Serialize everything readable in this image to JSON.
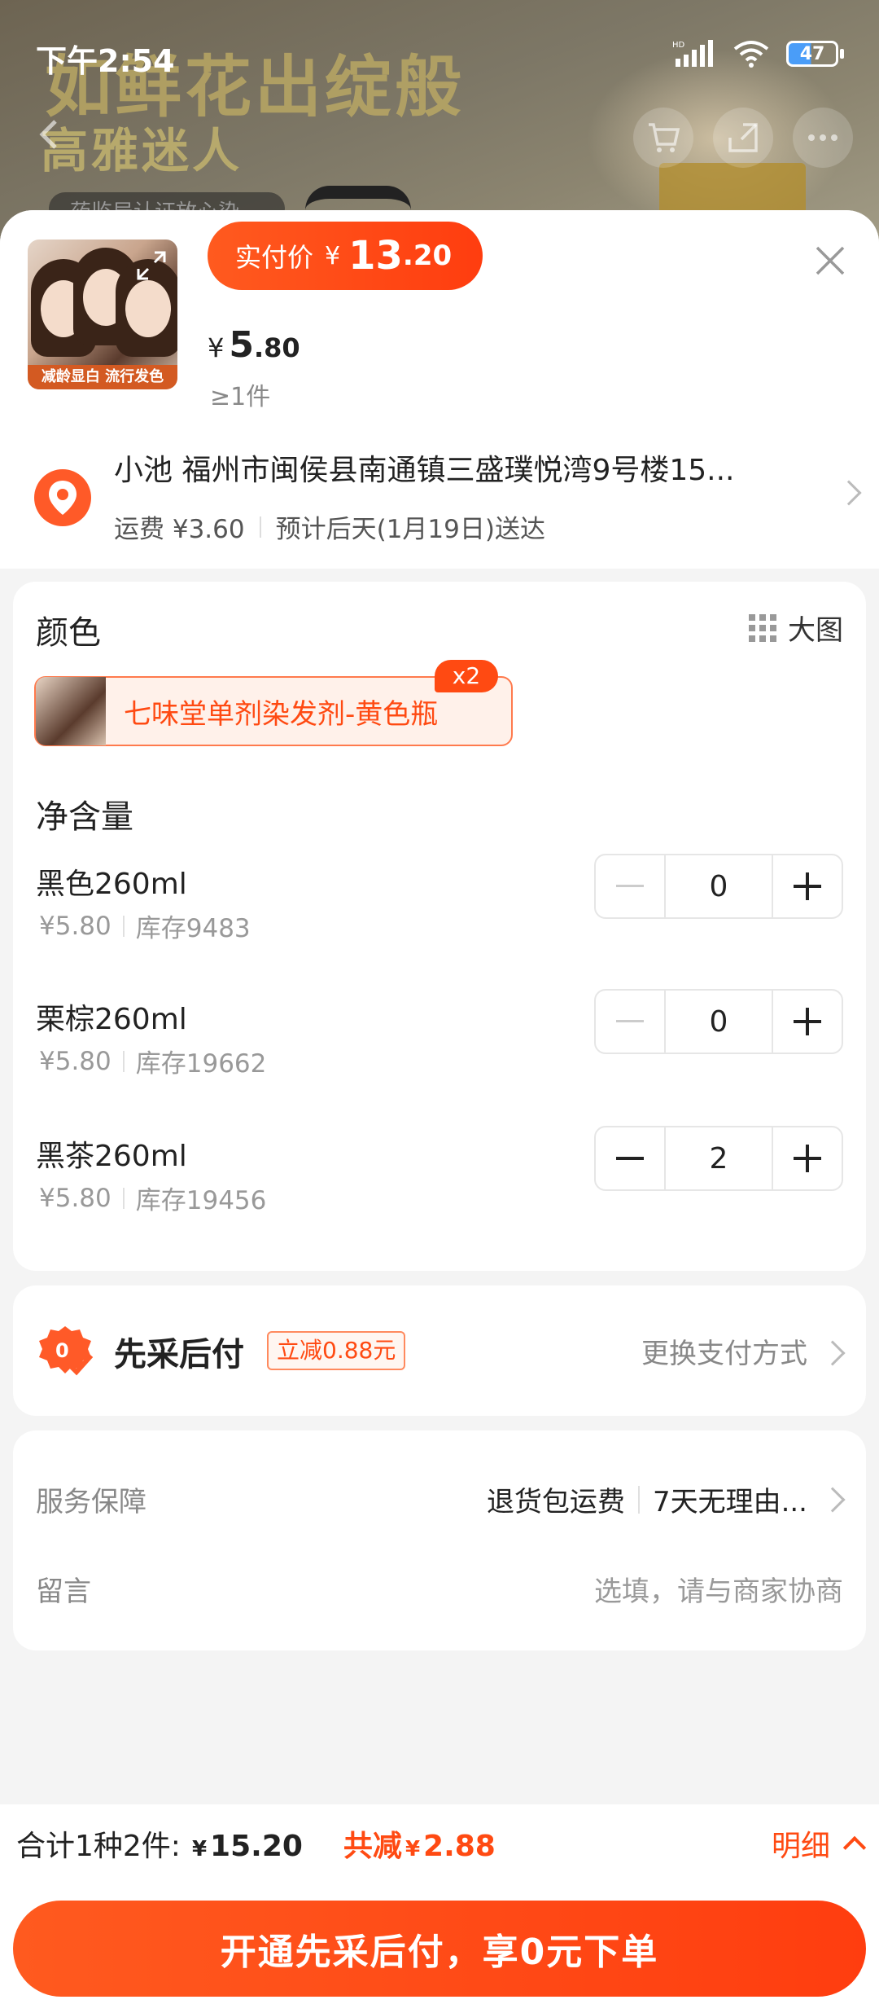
{
  "status_bar": {
    "time": "下午2:54",
    "battery": "47",
    "network": "HD"
  },
  "banner": {
    "title1": "如鲜花出绽般",
    "title2": "高雅迷人",
    "badge": "药监局认证放心染"
  },
  "product": {
    "thumb_caption": "减龄显白 流行发色",
    "actual_price_label": "实付价",
    "actual_price_currency": "¥",
    "actual_price_int": "13",
    "actual_price_dec": ".20",
    "unit_price_currency": "¥",
    "unit_price_int": "5",
    "unit_price_dec": ".80",
    "min_qty": "≥1件"
  },
  "address": {
    "line": "小池 福州市闽侯县南通镇三盛璞悦湾9号楼15...",
    "shipping_fee": "运费 ¥3.60",
    "delivery": "预计后天(1月19日)送达"
  },
  "spec": {
    "color_title": "颜色",
    "big_view": "大图",
    "color_option": {
      "label": "七味堂单剂染发剂-黄色瓶",
      "badge": "x2"
    },
    "volume_title": "净含量",
    "skus": [
      {
        "name": "黑色260ml",
        "price": "¥5.80",
        "stock": "库存9483",
        "qty": "0"
      },
      {
        "name": "栗棕260ml",
        "price": "¥5.80",
        "stock": "库存19662",
        "qty": "0"
      },
      {
        "name": "黑茶260ml",
        "price": "¥5.80",
        "stock": "库存19456",
        "qty": "2"
      }
    ]
  },
  "payment": {
    "title": "先采后付",
    "badge": "立减0.88元",
    "change": "更换支付方式"
  },
  "service": {
    "label": "服务保障",
    "item1": "退货包运费",
    "item2": "7天无理由...",
    "note_label": "留言",
    "note_placeholder": "选填，请与商家协商"
  },
  "footer": {
    "total_label": "合计1种2件:",
    "total_currency": "¥",
    "total_amount": "15.20",
    "save_label": "共减",
    "save_currency": "¥",
    "save_amount": "2.88",
    "detail": "明细",
    "cta": "开通先采后付，享0元下单"
  },
  "colors": {
    "accent": "#ff4a12",
    "accent_bg": "#fff1ea"
  }
}
